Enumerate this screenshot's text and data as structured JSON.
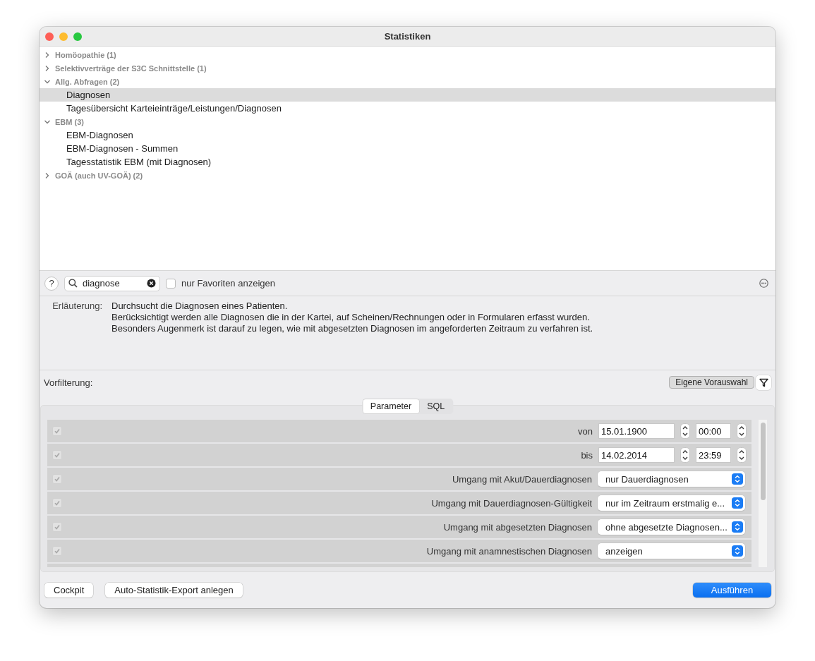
{
  "window": {
    "title": "Statistiken"
  },
  "tree": [
    {
      "label": "Homöopathie (1)",
      "expanded": false
    },
    {
      "label": "Selektivverträge der S3C Schnittstelle (1)",
      "expanded": false
    },
    {
      "label": "Allg. Abfragen (2)",
      "expanded": true,
      "children": [
        {
          "label": "Diagnosen",
          "selected": true
        },
        {
          "label": "Tagesübersicht Karteieinträge/Leistungen/Diagnosen",
          "selected": false
        }
      ]
    },
    {
      "label": "EBM (3)",
      "expanded": true,
      "children": [
        {
          "label": "EBM-Diagnosen",
          "selected": false
        },
        {
          "label": "EBM-Diagnosen - Summen",
          "selected": false
        },
        {
          "label": "Tagesstatistik EBM (mit Diagnosen)",
          "selected": false
        }
      ]
    },
    {
      "label": "GOÄ (auch UV-GOÄ) (2)",
      "expanded": false
    }
  ],
  "toolbar": {
    "help": "?",
    "search": {
      "value": "diagnose"
    },
    "favorites": {
      "label": "nur Favoriten anzeigen",
      "checked": false
    }
  },
  "description": {
    "label": "Erläuterung:",
    "lines": [
      "Durchsucht die Diagnosen eines Patienten.",
      "Berücksichtigt werden alle Diagnosen die in der Kartei, auf Scheinen/Rechnungen oder in Formularen erfasst wurden.",
      "Besonders Augenmerk ist darauf zu legen, wie mit abgesetzten Diagnosen im angeforderten Zeitraum zu verfahren ist."
    ]
  },
  "prefilter": {
    "label": "Vorfilterung:",
    "button": "Eigene Vorauswahl"
  },
  "tabs": [
    {
      "label": "Parameter",
      "selected": true
    },
    {
      "label": "SQL",
      "selected": false
    }
  ],
  "parameters": [
    {
      "kind": "datetime",
      "checked": true,
      "label": "von",
      "date": "15.01.1900",
      "time": "00:00"
    },
    {
      "kind": "datetime",
      "checked": true,
      "label": "bis",
      "date": "14.02.2014",
      "time": "23:59"
    },
    {
      "kind": "select",
      "checked": true,
      "label": "Umgang mit Akut/Dauerdiagnosen",
      "value": "nur Dauerdiagnosen"
    },
    {
      "kind": "select",
      "checked": true,
      "label": "Umgang mit Dauerdiagnosen-Gültigkeit",
      "value": "nur im Zeitraum erstmalig e..."
    },
    {
      "kind": "select",
      "checked": true,
      "label": "Umgang mit abgesetzten Diagnosen",
      "value": "ohne abgesetzte Diagnosen..."
    },
    {
      "kind": "select",
      "checked": true,
      "label": "Umgang mit anamnestischen Diagnosen",
      "value": "anzeigen"
    }
  ],
  "footer": {
    "left": [
      "Cockpit",
      "Auto-Statistik-Export anlegen"
    ],
    "primary": "Ausführen"
  }
}
